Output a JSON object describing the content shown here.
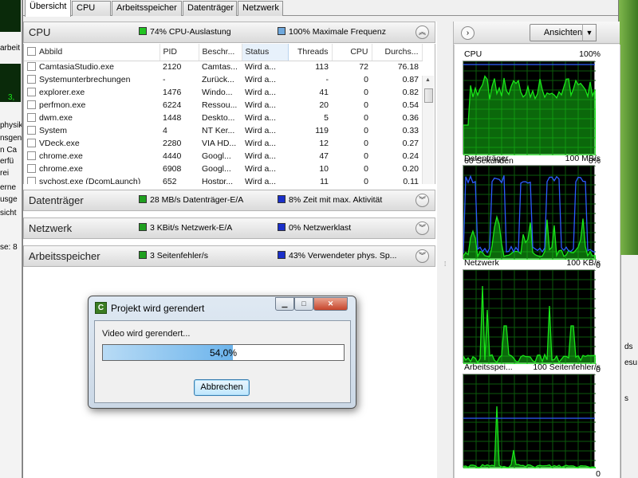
{
  "background": {
    "left_texts": [
      "arbeit",
      "3,",
      "physik",
      "nsgen",
      "n Ca",
      "erfü",
      "rei",
      "erne",
      "usge",
      "sicht",
      "se: 8"
    ],
    "right_texts": [
      "ds",
      "esu",
      "s"
    ]
  },
  "tabs": [
    {
      "label": "Übersicht",
      "active": true
    },
    {
      "label": "CPU",
      "active": false
    },
    {
      "label": "Arbeitsspeicher",
      "active": false
    },
    {
      "label": "Datenträger",
      "active": false
    },
    {
      "label": "Netzwerk",
      "active": false
    }
  ],
  "cpu_section": {
    "title": "CPU",
    "ind1": "74% CPU-Auslastung",
    "ind1_color": "#22c322",
    "ind2": "100% Maximale Frequenz",
    "ind2_color": "#6fa8dc",
    "expanded": true
  },
  "table": {
    "columns": [
      "Abbild",
      "PID",
      "Beschr...",
      "Status",
      "Threads",
      "CPU",
      "Durchs..."
    ],
    "sorted_column": "Status",
    "rows": [
      [
        "CamtasiaStudio.exe",
        "2120",
        "Camtas...",
        "Wird a...",
        "113",
        "72",
        "76.18"
      ],
      [
        "Systemunterbrechungen",
        "-",
        "Zurück...",
        "Wird a...",
        "-",
        "0",
        "0.87"
      ],
      [
        "explorer.exe",
        "1476",
        "Windo...",
        "Wird a...",
        "41",
        "0",
        "0.82"
      ],
      [
        "perfmon.exe",
        "6224",
        "Ressou...",
        "Wird a...",
        "20",
        "0",
        "0.54"
      ],
      [
        "dwm.exe",
        "1448",
        "Deskto...",
        "Wird a...",
        "5",
        "0",
        "0.36"
      ],
      [
        "System",
        "4",
        "NT Ker...",
        "Wird a...",
        "119",
        "0",
        "0.33"
      ],
      [
        "VDeck.exe",
        "2280",
        "VIA HD...",
        "Wird a...",
        "12",
        "0",
        "0.27"
      ],
      [
        "chrome.exe",
        "4440",
        "Googl...",
        "Wird a...",
        "47",
        "0",
        "0.24"
      ],
      [
        "chrome.exe",
        "6908",
        "Googl...",
        "Wird a...",
        "10",
        "0",
        "0.20"
      ],
      [
        "svchost.exe (DcomLaunch)",
        "652",
        "Hostpr...",
        "Wird a...",
        "11",
        "0",
        "0.11"
      ]
    ]
  },
  "disk_section": {
    "title": "Datenträger",
    "ind1": "28 MB/s Datenträger-E/A",
    "ind1_color": "#1f9f1f",
    "ind2": "8% Zeit mit max. Aktivität",
    "ind2_color": "#1a2fc9"
  },
  "net_section": {
    "title": "Netzwerk",
    "ind1": "3 KBit/s Netzwerk-E/A",
    "ind1_color": "#1f9f1f",
    "ind2": "0% Netzwerklast",
    "ind2_color": "#1a2fc9"
  },
  "mem_section": {
    "title": "Arbeitsspeicher",
    "ind1": "3 Seitenfehler/s",
    "ind1_color": "#1f9f1f",
    "ind2": "43% Verwendeter phys. Sp...",
    "ind2_color": "#1a2fc9"
  },
  "right_pane": {
    "view_label": "Ansichten",
    "graphs": [
      {
        "name": "CPU",
        "max": "100%",
        "footer_left": "60 Sekunden",
        "footer_right": "0%"
      },
      {
        "name": "Datenträger",
        "max": "100 MB/s",
        "footer_left": "",
        "footer_right": "0"
      },
      {
        "name": "Netzwerk",
        "max": "100 KB/s",
        "footer_left": "",
        "footer_right": "0"
      },
      {
        "name": "Arbeitsspei...",
        "max": "100 Seitenfehler/s",
        "footer_left": "",
        "footer_right": "0"
      }
    ]
  },
  "dialog": {
    "title": "Projekt wird gerendert",
    "icon_letter": "C",
    "message": "Video wird gerendert...",
    "progress_fraction": 0.54,
    "progress_text": "54,0%",
    "cancel_label": "Abbrechen"
  },
  "colors": {
    "graph_green": "#19e619",
    "graph_blue": "#2c5cff",
    "grid": "#0b5a0b"
  }
}
